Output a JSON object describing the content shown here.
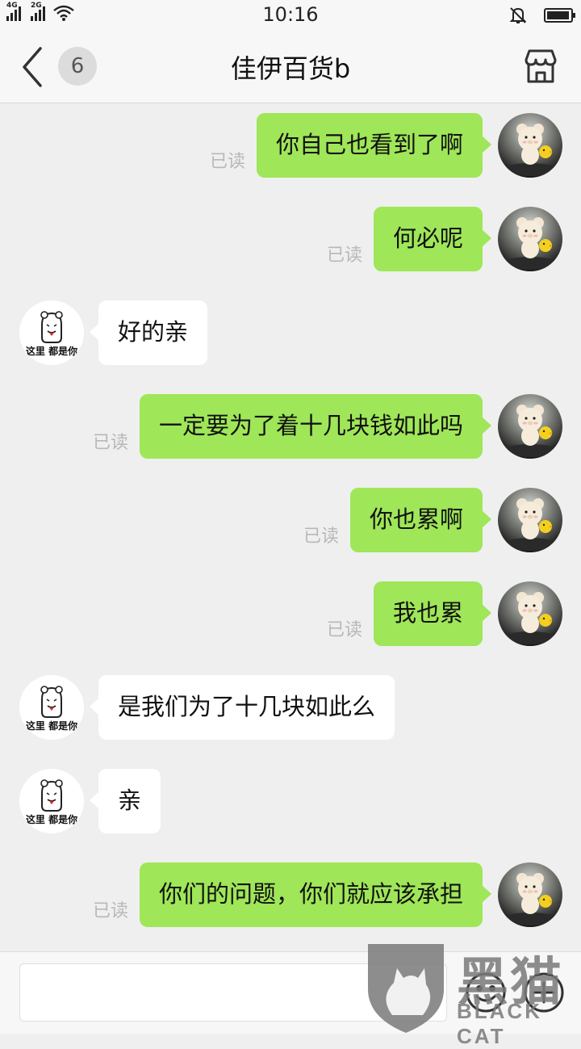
{
  "status_bar": {
    "time": "10:16",
    "signal_1_label": "4G",
    "signal_2_label": "2G",
    "icons": [
      "signal-4g-icon",
      "signal-2g-icon",
      "wifi-icon",
      "mute-bell-icon",
      "battery-icon"
    ]
  },
  "header": {
    "title": "佳伊百货b",
    "unread_count": "6",
    "back_icon": "chevron-left-icon",
    "shop_icon": "shop-icon"
  },
  "messages": [
    {
      "side": "out",
      "text": "你自己也看到了啊",
      "status": "已读"
    },
    {
      "side": "out",
      "text": "何必呢",
      "status": "已读"
    },
    {
      "side": "in",
      "text": "好的亲"
    },
    {
      "side": "out",
      "text": "一定要为了着十几块钱如此吗",
      "status": "已读"
    },
    {
      "side": "out",
      "text": "你也累啊",
      "status": "已读"
    },
    {
      "side": "out",
      "text": "我也累",
      "status": "已读"
    },
    {
      "side": "in",
      "text": "是我们为了十几块如此么"
    },
    {
      "side": "in",
      "text": "亲"
    },
    {
      "side": "out",
      "text": "你们的问题，你们就应该承担",
      "status": "已读"
    }
  ],
  "seller_avatar_caption": "这里 都是你",
  "input_bar": {
    "value": "",
    "emoji_icon": "emoji-icon",
    "plus_icon": "plus-icon"
  },
  "watermark": {
    "cn": "黑猫",
    "en": "BLACK CAT"
  },
  "colors": {
    "outgoing_bubble": "#9fe658",
    "incoming_bubble": "#ffffff",
    "background": "#efefef"
  }
}
